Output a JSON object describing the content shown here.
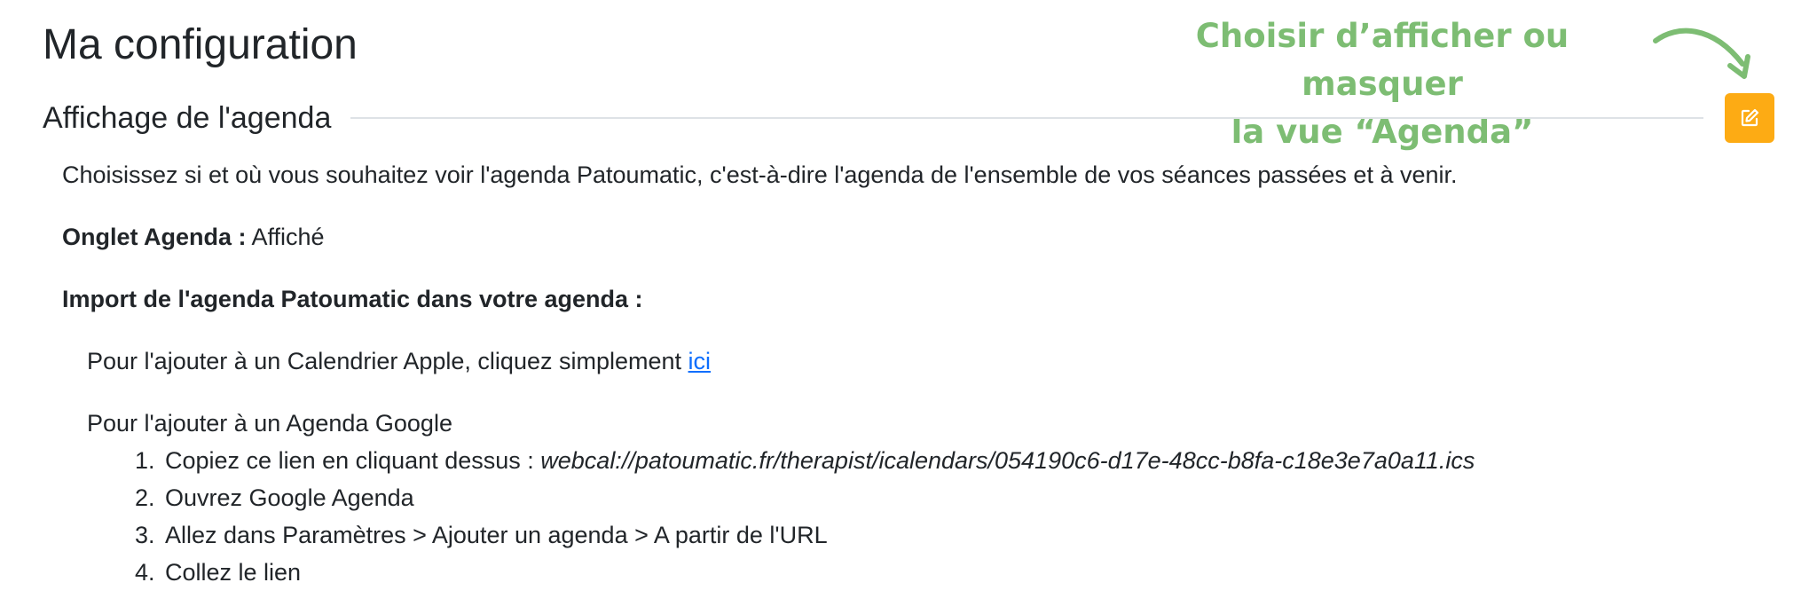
{
  "page": {
    "title": "Ma configuration"
  },
  "annotation": {
    "line1": "Choisir d’afficher ou masquer",
    "line2": "la vue “Agenda”",
    "color": "#7dbd73"
  },
  "section": {
    "title": "Affichage de l'agenda",
    "edit_icon": "edit-icon",
    "edit_color": "#fdab14"
  },
  "content": {
    "intro": "Choisissez si et où vous souhaitez voir l'agenda Patoumatic, c'est-à-dire l'agenda de l'ensemble de vos séances passées et à venir.",
    "tab_label": "Onglet Agenda :",
    "tab_value": "Affiché",
    "import_heading": "Import de l'agenda Patoumatic dans votre agenda :",
    "apple_text": "Pour l'ajouter à un Calendrier Apple, cliquez simplement",
    "apple_link": "ici",
    "google_intro": "Pour l'ajouter à un Agenda Google",
    "steps": [
      "Copiez ce lien en cliquant dessus :",
      "Ouvrez Google Agenda",
      "Allez dans Paramètres > Ajouter un agenda > A partir de l'URL",
      "Collez le lien"
    ],
    "webcal_url": "webcal://patoumatic.fr/therapist/icalendars/054190c6-d17e-48cc-b8fa-c18e3e7a0a11.ics"
  }
}
